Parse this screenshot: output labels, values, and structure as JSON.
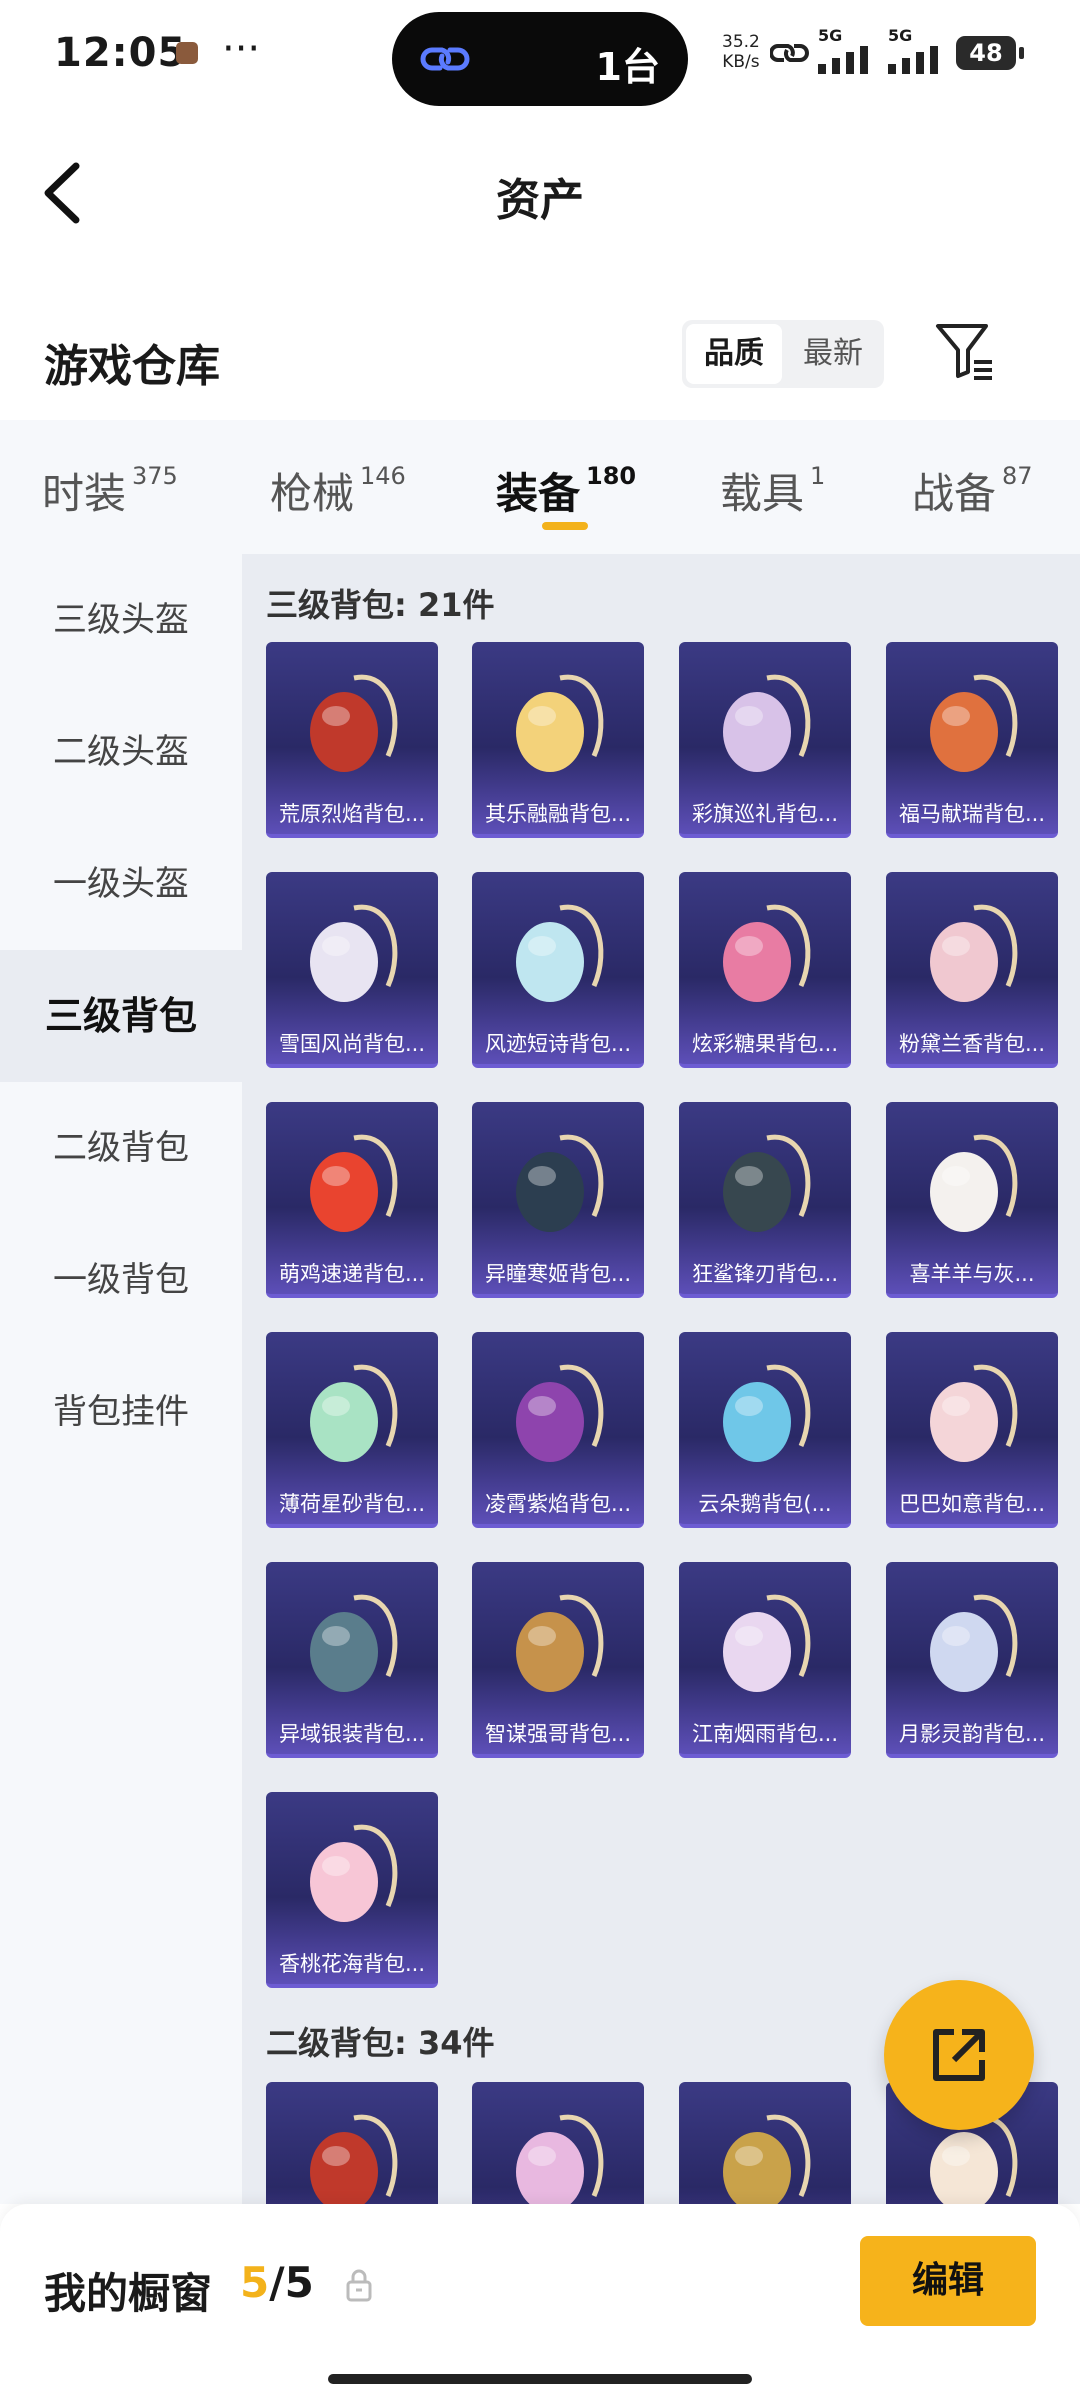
{
  "status": {
    "time": "12:05",
    "dots": "···",
    "island_text": "1台",
    "net_speed_value": "35.2",
    "net_speed_unit": "KB/s",
    "sig1": "5G",
    "sig2": "5G",
    "battery": "48"
  },
  "header": {
    "title": "资产"
  },
  "warehouse": {
    "title": "游戏仓库",
    "sort_quality": "品质",
    "sort_newest": "最新"
  },
  "tabs": [
    {
      "label": "时装",
      "count": "375"
    },
    {
      "label": "枪械",
      "count": "146"
    },
    {
      "label": "装备",
      "count": "180"
    },
    {
      "label": "载具",
      "count": "1"
    },
    {
      "label": "战备",
      "count": "87"
    }
  ],
  "categories": [
    "三级头盔",
    "二级头盔",
    "一级头盔",
    "三级背包",
    "二级背包",
    "一级背包",
    "背包挂件"
  ],
  "sections": [
    {
      "title": "三级背包: 21件",
      "items": [
        "荒原烈焰背包...",
        "其乐融融背包...",
        "彩旗巡礼背包...",
        "福马献瑞背包...",
        "雪国风尚背包...",
        "风迹短诗背包...",
        "炫彩糖果背包...",
        "粉黛兰香背包...",
        "萌鸡速递背包...",
        "异瞳寒姬背包...",
        "狂鲨锋刃背包...",
        "喜羊羊与灰...",
        "薄荷星砂背包...",
        "凌霄紫焰背包...",
        "云朵鹅背包(...",
        "巴巴如意背包...",
        "异域银装背包...",
        "智谋强哥背包...",
        "江南烟雨背包...",
        "月影灵韵背包...",
        "香桃花海背包..."
      ]
    },
    {
      "title": "二级背包: 34件",
      "items": [
        "",
        "",
        "",
        ""
      ]
    }
  ],
  "bottom": {
    "showcase": "我的橱窗",
    "count_current": "5",
    "count_sep": "/",
    "count_total": "5",
    "edit": "编辑"
  },
  "colors": {
    "accent": "#f6b31b",
    "card_top": "#3b3a84",
    "card_bottom": "#5d4fb8"
  }
}
